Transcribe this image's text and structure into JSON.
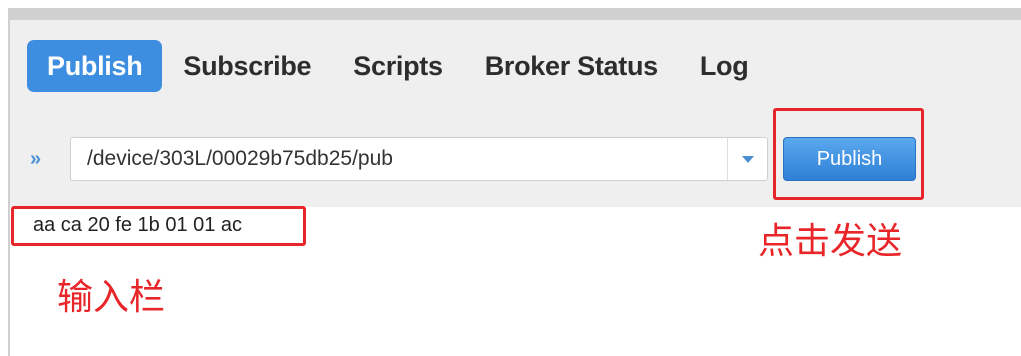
{
  "tabs": [
    {
      "label": "Publish",
      "active": true
    },
    {
      "label": "Subscribe",
      "active": false
    },
    {
      "label": "Scripts",
      "active": false
    },
    {
      "label": "Broker Status",
      "active": false
    },
    {
      "label": "Log",
      "active": false
    }
  ],
  "toolbar": {
    "chevron": "»",
    "topic_value": "/device/303L/00029b75db25/pub",
    "publish_label": "Publish"
  },
  "message": {
    "text": "aa ca 20 fe 1b 01 01 ac"
  },
  "annotations": {
    "send_label": "点击发送",
    "input_label": "输入栏"
  },
  "colors": {
    "accent": "#3d8ee0",
    "annotation_red": "#e8262a"
  }
}
